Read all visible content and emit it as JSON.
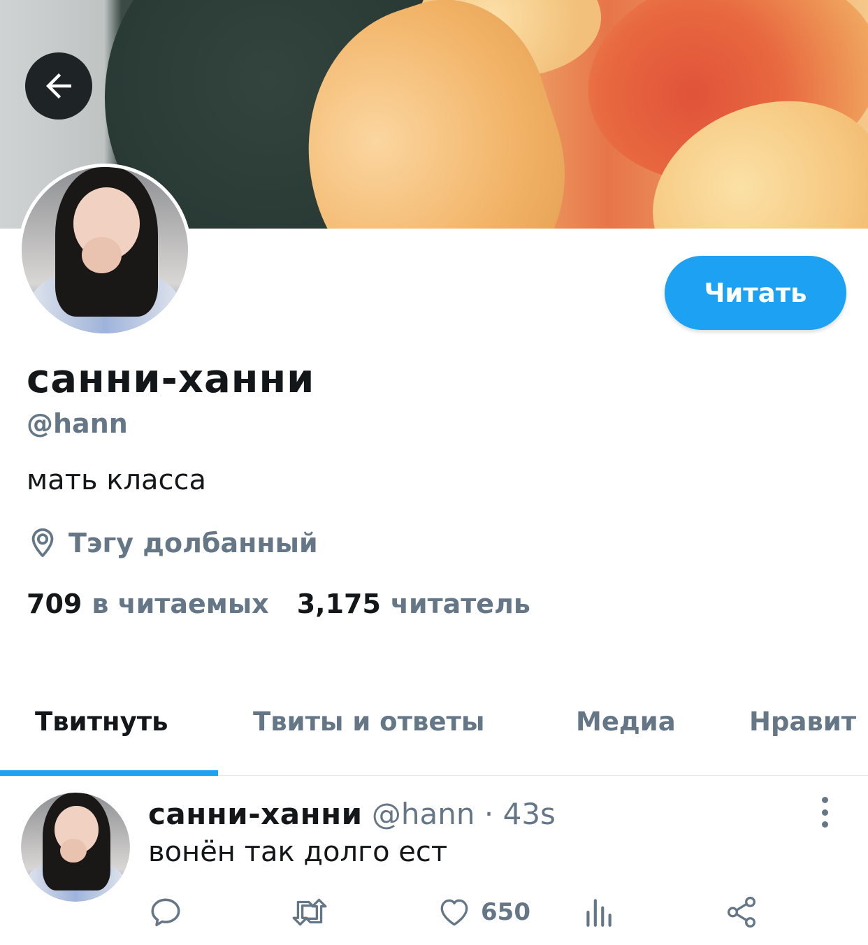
{
  "header": {
    "back_icon": "arrow-left-icon",
    "banner_colors": [
      "#2c3d37",
      "#f2b468",
      "#e0533a"
    ]
  },
  "profile": {
    "follow_label": "Читать",
    "display_name": "санни-ханни",
    "handle": "@hann",
    "bio": "мать класса",
    "location_icon": "location-pin-icon",
    "location": "Тэгу долбанный",
    "following_count": "709",
    "following_label": "в читаемых",
    "followers_count": "3,175",
    "followers_label": "читатель",
    "accent_color": "#1da1f2"
  },
  "tabs": [
    {
      "label": "Твитнуть",
      "active": true
    },
    {
      "label": "Твиты и ответы",
      "active": false
    },
    {
      "label": "Медиа",
      "active": false
    },
    {
      "label": "Нравит",
      "active": false
    }
  ],
  "tweet": {
    "name": "санни-ханни",
    "handle": "@hann",
    "separator": "·",
    "time": "43s",
    "text": "вонён так долго ест",
    "like_count": "650",
    "actions": [
      "reply-icon",
      "retweet-icon",
      "like-icon",
      "analytics-icon",
      "share-icon"
    ]
  }
}
